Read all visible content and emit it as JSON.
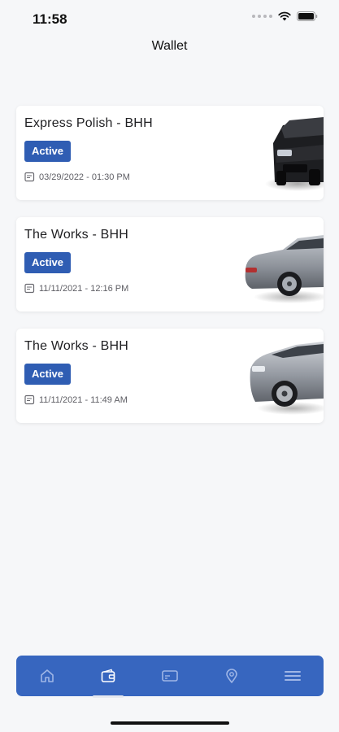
{
  "status_bar": {
    "time": "11:58"
  },
  "header": {
    "title": "Wallet"
  },
  "cards": [
    {
      "title": "Express Polish - BHH",
      "status": "Active",
      "date": "03/29/2022 - 01:30 PM",
      "image": "black-car-front"
    },
    {
      "title": "The Works - BHH",
      "status": "Active",
      "date": "11/11/2021 - 12:16 PM",
      "image": "silver-car-rear"
    },
    {
      "title": "The Works - BHH",
      "status": "Active",
      "date": "11/11/2021 - 11:49 AM",
      "image": "silver-car-front"
    }
  ],
  "tab_bar": {
    "items": [
      {
        "icon": "home-icon"
      },
      {
        "icon": "wallet-icon",
        "active": true
      },
      {
        "icon": "card-icon"
      },
      {
        "icon": "location-icon"
      },
      {
        "icon": "menu-icon"
      }
    ]
  },
  "colors": {
    "accent": "#3766bf",
    "badge": "#2f5db3",
    "background": "#f6f7f9"
  }
}
